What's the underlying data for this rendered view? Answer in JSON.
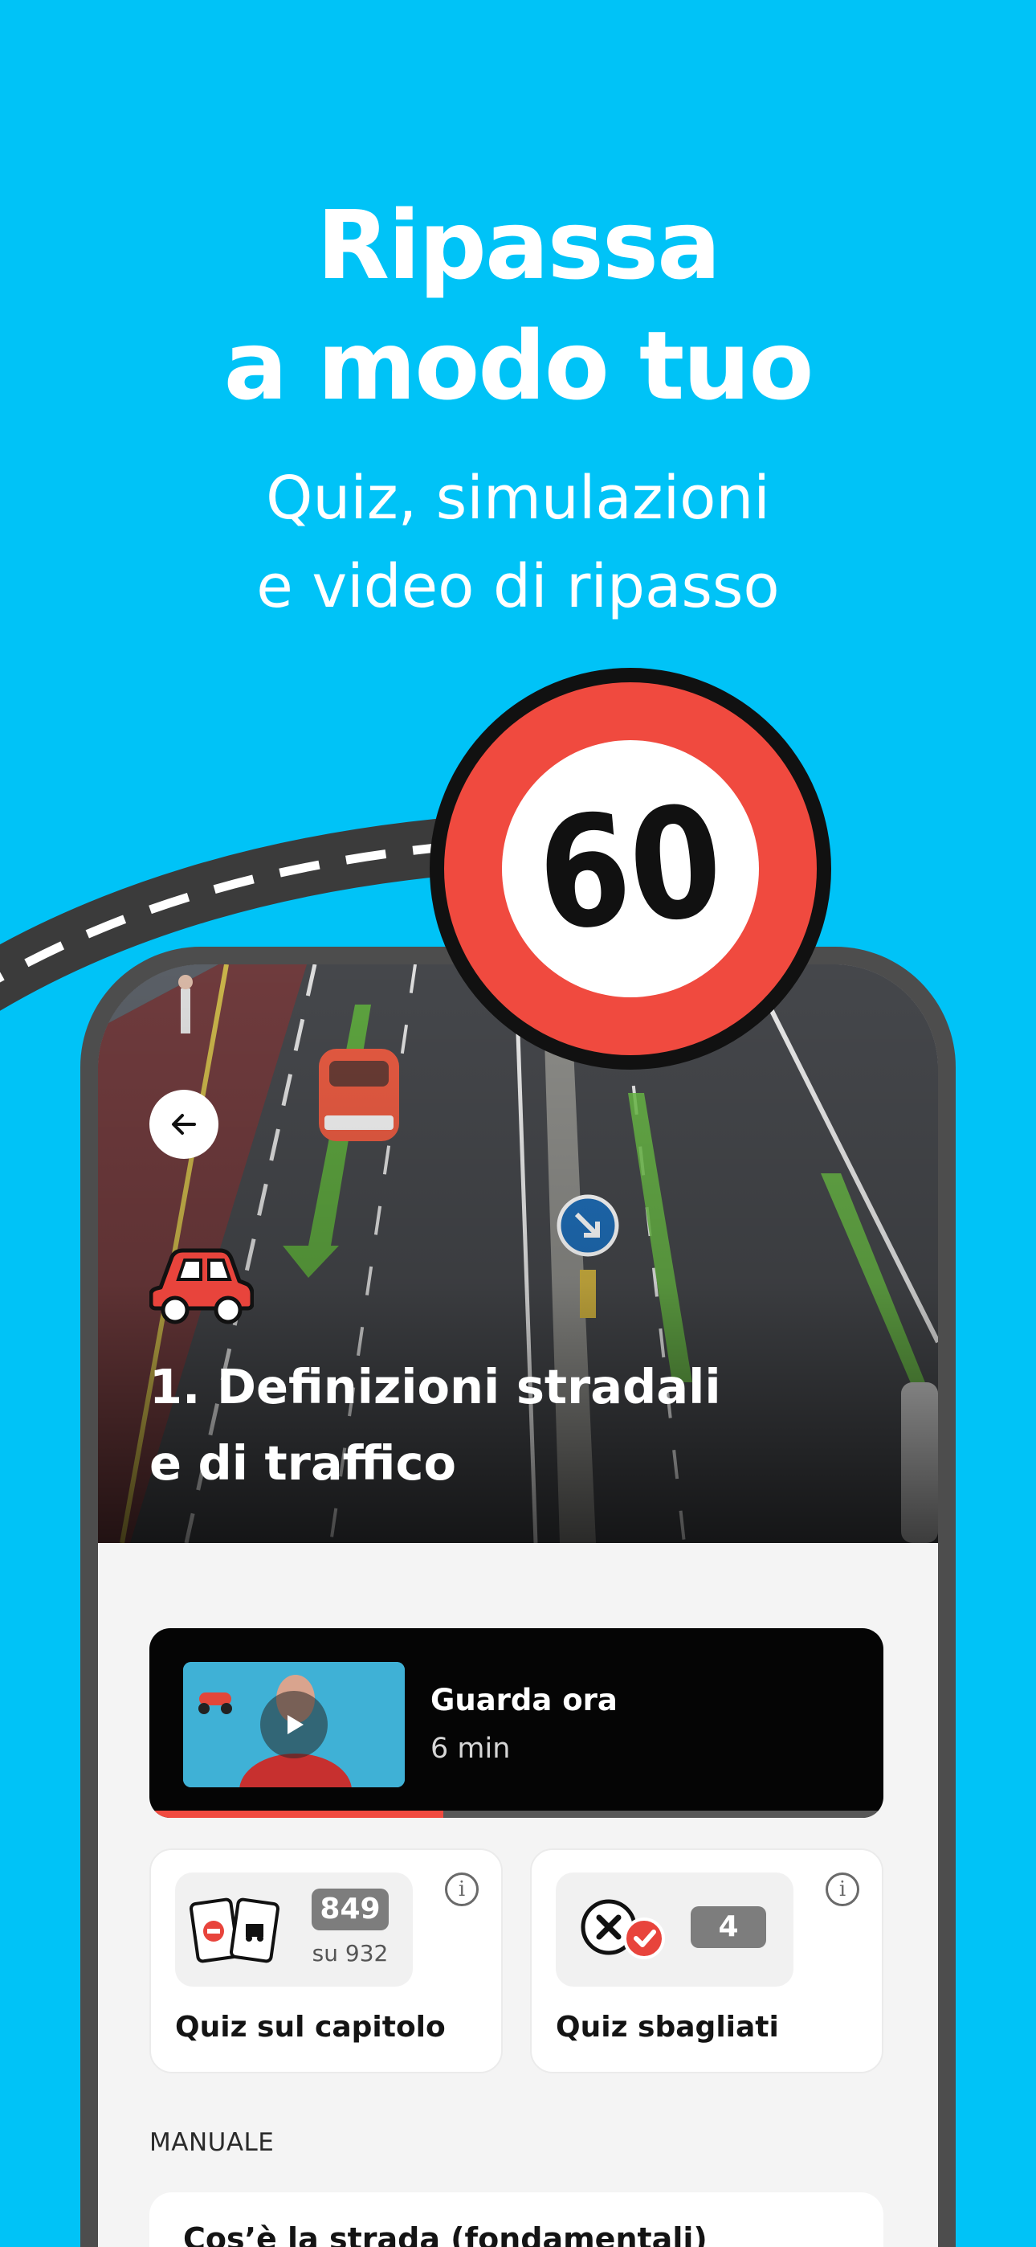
{
  "header": {
    "title_lines": [
      "Ripassa",
      "a modo tuo"
    ],
    "subtitle_lines": [
      "Quiz, simulazioni",
      "e video di ripasso"
    ]
  },
  "speed_sign": {
    "value": "60"
  },
  "chapter": {
    "title_lines": [
      "1. Definizioni stradali",
      "e di traffico"
    ],
    "icons": {
      "back": "arrow-left-icon",
      "category": "car-icon"
    }
  },
  "video": {
    "title": "Guarda ora",
    "duration": "6 min",
    "progress": 0.4,
    "icon": "play-icon"
  },
  "quiz_cards": [
    {
      "label": "Quiz sul capitolo",
      "count": "849",
      "total": "su 932",
      "icon": "quiz-cards-icon"
    },
    {
      "label": "Quiz sbagliati",
      "count": "4",
      "icon": "wrong-answers-icon"
    }
  ],
  "manual": {
    "section_label": "MANUALE",
    "items": [
      {
        "title": "Cos’è la strada (fondamentali)",
        "completed": true
      }
    ]
  },
  "colors": {
    "background": "#00c3f7",
    "accent_red": "#f04a3f",
    "check_green": "#1fb55a"
  }
}
